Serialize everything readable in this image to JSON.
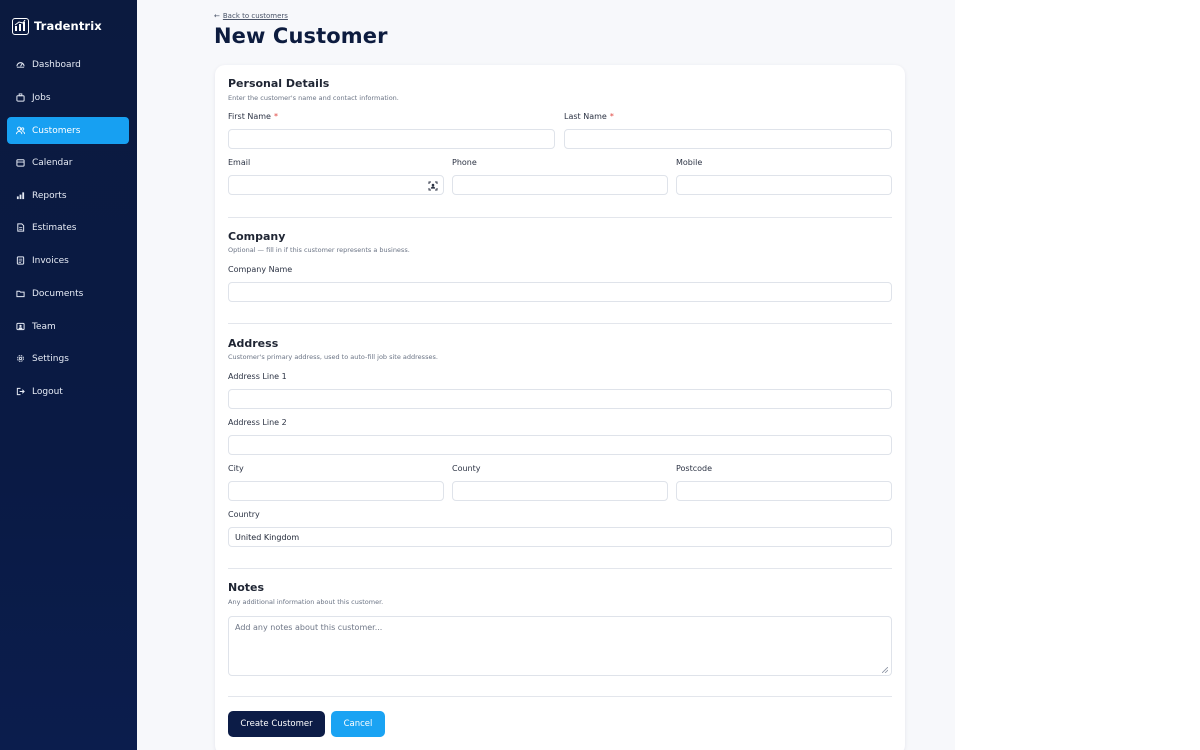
{
  "brand": {
    "name": "Tradentrix"
  },
  "sidebar": {
    "items": [
      {
        "label": "Dashboard",
        "icon": "dashboard-icon",
        "active": false
      },
      {
        "label": "Jobs",
        "icon": "briefcase-icon",
        "active": false
      },
      {
        "label": "Customers",
        "icon": "users-icon",
        "active": true
      },
      {
        "label": "Calendar",
        "icon": "calendar-icon",
        "active": false
      },
      {
        "label": "Reports",
        "icon": "bar-chart-icon",
        "active": false
      },
      {
        "label": "Estimates",
        "icon": "document-icon",
        "active": false
      },
      {
        "label": "Invoices",
        "icon": "invoice-icon",
        "active": false
      },
      {
        "label": "Documents",
        "icon": "folder-icon",
        "active": false
      },
      {
        "label": "Team",
        "icon": "team-icon",
        "active": false
      },
      {
        "label": "Settings",
        "icon": "gear-icon",
        "active": false
      },
      {
        "label": "Logout",
        "icon": "logout-icon",
        "active": false
      }
    ]
  },
  "header": {
    "back_link": "Back to customers",
    "title": "New Customer"
  },
  "form": {
    "personal": {
      "title": "Personal Details",
      "subtitle": "Enter the customer's name and contact information.",
      "first_name_label": "First Name",
      "last_name_label": "Last Name",
      "email_label": "Email",
      "phone_label": "Phone",
      "mobile_label": "Mobile",
      "required_mark": "*"
    },
    "company": {
      "title": "Company",
      "subtitle": "Optional — fill in if this customer represents a business.",
      "company_name_label": "Company Name"
    },
    "address": {
      "title": "Address",
      "subtitle": "Customer's primary address, used to auto-fill job site addresses.",
      "line1_label": "Address Line 1",
      "line2_label": "Address Line 2",
      "city_label": "City",
      "county_label": "County",
      "postcode_label": "Postcode",
      "country_label": "Country",
      "country_value": "United Kingdom"
    },
    "notes": {
      "title": "Notes",
      "subtitle": "Any additional information about this customer.",
      "placeholder": "Add any notes about this customer..."
    },
    "actions": {
      "create_label": "Create Customer",
      "cancel_label": "Cancel"
    }
  },
  "colors": {
    "sidebar_bg": "#0b1a3f",
    "accent": "#17a0f2",
    "primary_button": "#0c1c47",
    "required": "#e0453f"
  }
}
